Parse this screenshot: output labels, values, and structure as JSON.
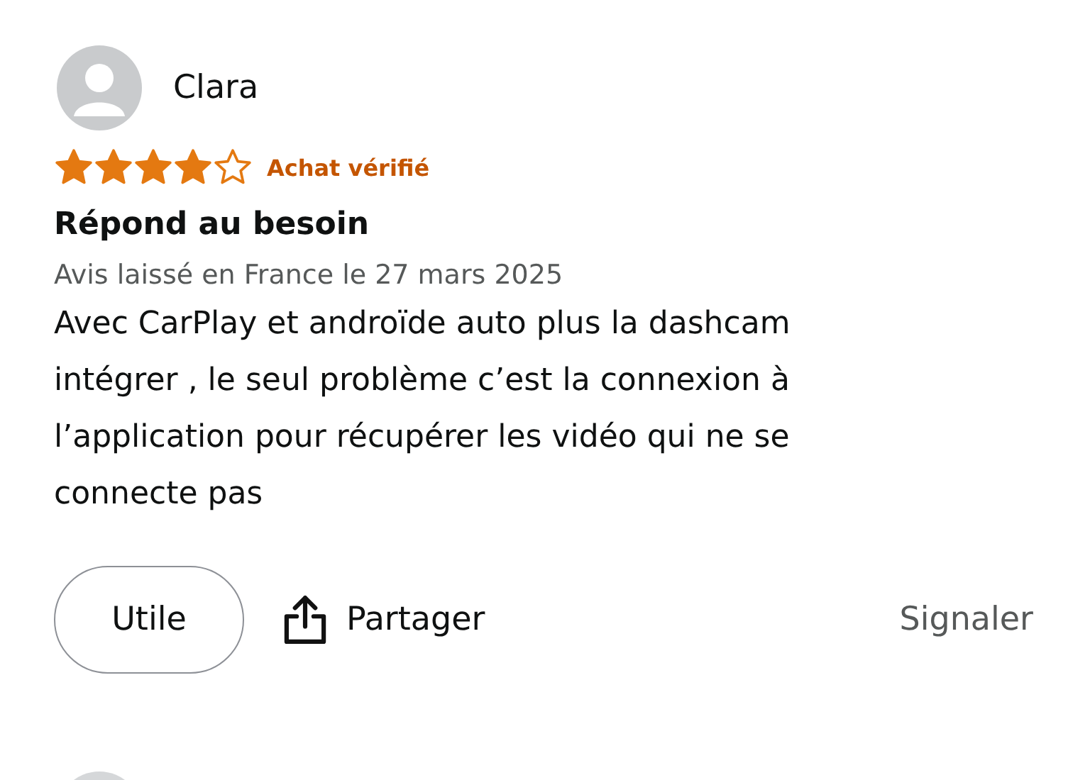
{
  "review": {
    "author": "Clara",
    "stars": 4,
    "badge": "Achat vérifié",
    "title": "Répond au besoin",
    "date": "Avis laissé en France le 27 mars 2025",
    "body": "Avec CarPlay et androïde auto plus la dashcam intégrer , le seul problème c’est la connexion à l’application pour récupérer les vidéo qui ne se connecte pas",
    "actions": {
      "helpful": "Utile",
      "share": "Partager",
      "report": "Signaler"
    }
  }
}
